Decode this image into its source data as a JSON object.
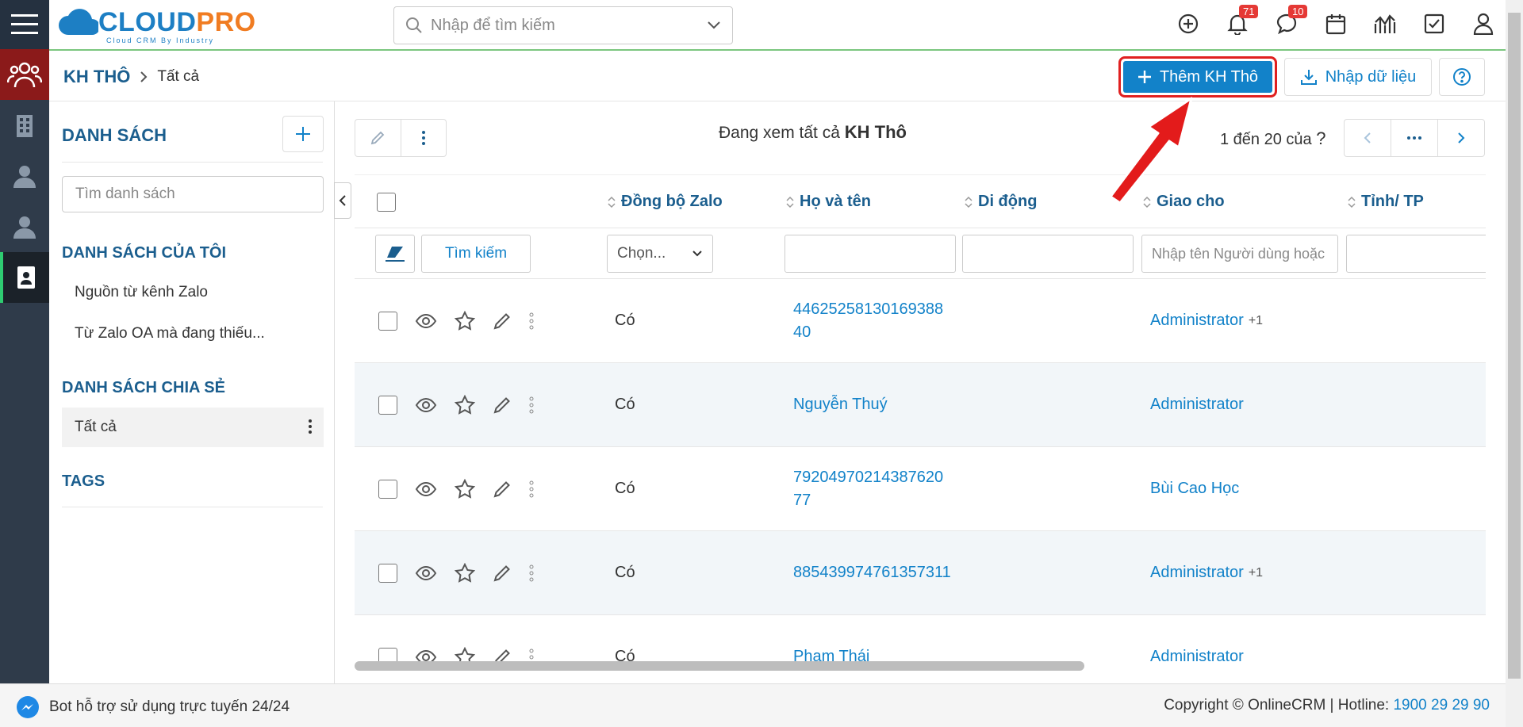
{
  "header": {
    "logo_cloud": "CLOUD",
    "logo_pro": "PRO",
    "logo_tagline": "Cloud CRM By Industry",
    "search_placeholder": "Nhập để tìm kiếm",
    "notifications_count": "71",
    "messages_count": "10"
  },
  "breadcrumb": {
    "main": "KH THÔ",
    "sub": "Tất cả"
  },
  "actions": {
    "add_label": "Thêm KH Thô",
    "import_label": "Nhập dữ liệu"
  },
  "sidebar": {
    "title": "DANH SÁCH",
    "search_placeholder": "Tìm danh sách",
    "my_lists_title": "DANH SÁCH CỦA TÔI",
    "my_lists": [
      "Nguồn từ kênh Zalo",
      "Từ Zalo OA mà đang thiếu..."
    ],
    "shared_title": "DANH SÁCH CHIA SẺ",
    "shared": [
      "Tất cả"
    ],
    "tags_title": "TAGS"
  },
  "main": {
    "viewing_prefix": "Đang xem tất cả",
    "viewing_entity": "KH Thô",
    "pager_text": "1 đến 20 của",
    "pager_unknown": "?",
    "search_button": "Tìm kiếm",
    "columns": [
      "Đồng bộ Zalo",
      "Họ và tên",
      "Di động",
      "Giao cho",
      "Tỉnh/ TP"
    ],
    "filter_select": "Chọn...",
    "filter_assign_placeholder": "Nhập tên Người dùng hoặc",
    "rows": [
      {
        "zalo": "Có",
        "name": "4462525813016938840",
        "assign": "Administrator",
        "more": "+1"
      },
      {
        "zalo": "Có",
        "name": "Nguyễn Thuý",
        "assign": "Administrator",
        "more": ""
      },
      {
        "zalo": "Có",
        "name": "7920497021438762077",
        "assign": "Bùi Cao Học",
        "more": ""
      },
      {
        "zalo": "Có",
        "name": "885439974761357311",
        "assign": "Administrator",
        "more": "+1"
      },
      {
        "zalo": "Có",
        "name": "Phạm Thái",
        "assign": "Administrator",
        "more": ""
      }
    ]
  },
  "footer": {
    "bot_text": "Bot hỗ trợ sử dụng trực tuyến 24/24",
    "copyright": "Copyright © OnlineCRM",
    "hotline_label": "Hotline:",
    "hotline": "1900 29 29 90"
  },
  "colors": {
    "primary": "#1282c9",
    "rail": "#2f3b4a",
    "highlight": "#e02020"
  }
}
